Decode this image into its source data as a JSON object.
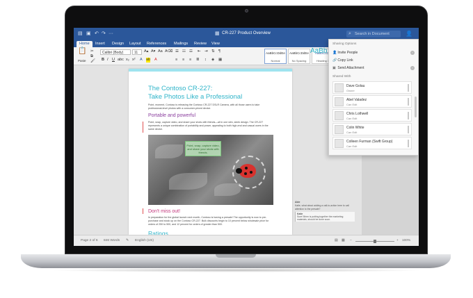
{
  "window": {
    "title": "CR-227 Product Overview",
    "search_placeholder": "Search in Document"
  },
  "tabs": [
    "Home",
    "Insert",
    "Design",
    "Layout",
    "References",
    "Mailings",
    "Review",
    "View"
  ],
  "ribbon": {
    "paste_label": "Paste",
    "font_name": "Calibri (Body)",
    "font_size": "11",
    "styles": [
      {
        "preview": "AaBbCcDdEe",
        "name": "Normal"
      },
      {
        "preview": "AaBbCcDdEe",
        "name": "No Spacing"
      },
      {
        "preview": "AaBbCcDd",
        "name": "Heading 1"
      }
    ],
    "big_style_preview": "AaBb"
  },
  "document": {
    "title_line1": "The Contoso CR-227:",
    "title_line2": "Take Photos Like a Professional",
    "intro": "Point, moment, Contoso is releasing the Contoso CR-227 DSLR Camera, with all those users to take professional-level photos with a consumer-priced device.",
    "heading_portable": "Portable and powerful",
    "portable_text": "Point, snap, capture video, and share your shots with friends—all in one slim, sleek design. The CR-227 represents a unique combination of portability and power, appealing to both high-end and casual users in the same device.",
    "photo_callout": "Point, snap, capture video, and share your shots with friends.",
    "heading_dontmiss": "Don't miss out!",
    "dontmiss_text": "In preparation for the global launch next month, Contoso is having a presale! The opportunity is now to pre-purchase and stock up on the Contoso CR-227. Bulk discounts begin to 10 percent below wholesale price for orders of 250 to 500, and 12 percent for orders of greater than 500.",
    "heading_ratings": "Ratings"
  },
  "comments": {
    "author1": "Abie",
    "text1": "Katie, what about adding a call-to-action here to call attention to the presale?",
    "author2": "Katie",
    "text2": "Sure! Brien is putting together the marketing materials; should be done soon."
  },
  "status": {
    "page": "Page 2 of 6",
    "words": "846 Words",
    "language": "English (US)",
    "zoom": "100%"
  },
  "share_panel": {
    "section_options": "Sharing Options",
    "options": [
      "Invite People",
      "Copy Link",
      "Send Attachment"
    ],
    "section_shared": "Shared With",
    "people": [
      {
        "name": "Dave Golau",
        "permission": "Owner"
      },
      {
        "name": "Abel Valadez",
        "permission": "Can Edit"
      },
      {
        "name": "Chris Lothwell",
        "permission": "Can Edit"
      },
      {
        "name": "Colin White",
        "permission": "Can Edit"
      },
      {
        "name": "Colleen Furman (Swift Group)",
        "permission": "Can Edit"
      }
    ]
  },
  "colors": {
    "word_blue": "#2b579a",
    "heading_teal": "#2fb4c9",
    "heading_purple": "#8a3e9e",
    "heading_pink": "#c2357c"
  }
}
